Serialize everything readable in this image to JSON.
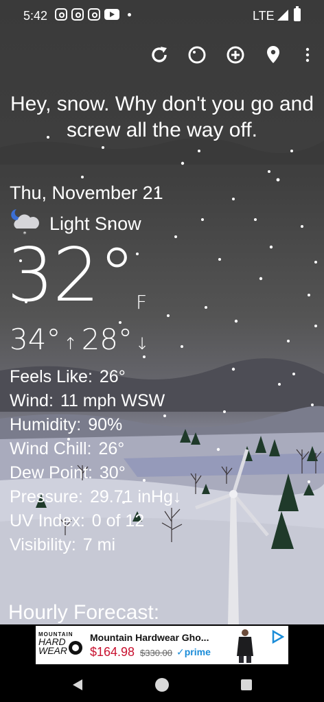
{
  "status_bar": {
    "time": "5:42",
    "notification_icons": [
      "instagram-icon",
      "instagram-icon",
      "instagram-icon",
      "youtube-icon",
      "dot-icon"
    ],
    "network": "LTE"
  },
  "toolbar": {
    "icons": [
      "refresh-icon",
      "theme-icon",
      "add-location-icon",
      "location-icon",
      "more-icon"
    ]
  },
  "headline": "Hey, snow. Why don't you go and screw all the way off.",
  "weather": {
    "date": "Thu, November 21",
    "condition_icon": "night-snow-cloud-icon",
    "condition": "Light Snow",
    "temperature": "32°",
    "unit": "F",
    "high": "34°",
    "low": "28°",
    "high_arrow": "↑",
    "low_arrow": "↓"
  },
  "details": [
    {
      "label": "Feels Like:",
      "value": "26°"
    },
    {
      "label": "Wind:",
      "value": "11 mph WSW"
    },
    {
      "label": "Humidity:",
      "value": "90%"
    },
    {
      "label": "Wind Chill:",
      "value": "26°"
    },
    {
      "label": "Dew Point:",
      "value": "30°"
    },
    {
      "label": "Pressure:",
      "value": "29.71 inHg↓"
    },
    {
      "label": "UV Index:",
      "value": "0 of 12"
    },
    {
      "label": "Visibility:",
      "value": "7 mi"
    }
  ],
  "hourly_title": "Hourly Forecast:",
  "ad": {
    "brand_line1": "MOUNTAIN",
    "brand_line2": "HARD",
    "brand_line3": "WEAR",
    "title": "Mountain Hardwear Gho...",
    "price": "$164.98",
    "old_price": "$330.00",
    "prime": "✓prime",
    "badge_icon": "ad-choices-icon"
  },
  "nav": {
    "icons": [
      "back-icon",
      "home-icon",
      "recents-icon"
    ]
  },
  "colors": {
    "text": "#ffffff",
    "sky": "#3d3d3d",
    "snow_ground": "#d0d2de",
    "price_red": "#c8102e",
    "prime_blue": "#1a8cd8"
  }
}
